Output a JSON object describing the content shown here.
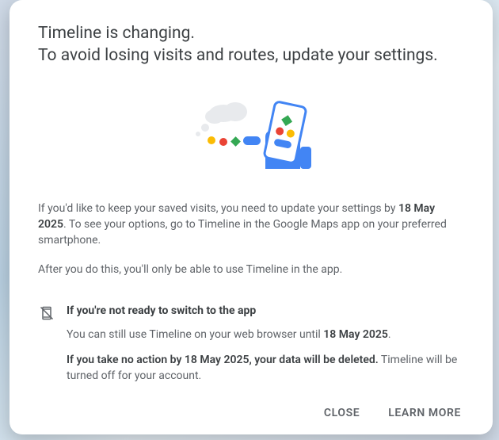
{
  "title": {
    "line1": "Timeline is changing.",
    "line2": "To avoid losing visits and routes, update your settings."
  },
  "body": {
    "p1_pre": "If you'd like to keep your saved visits, you need to update your settings by ",
    "p1_bold": "18 May 2025",
    "p1_post": ". To see your options, go to Timeline in the Google Maps app on your preferred smartphone.",
    "p2": "After you do this, you'll only be able to use Timeline in the app."
  },
  "section": {
    "heading": "If you're not ready to switch to the app",
    "line1_pre": "You can still use Timeline on your web browser until ",
    "line1_bold": "18 May 2025",
    "line1_post": ".",
    "line2_bold": "If you take no action by 18 May 2025, your data will be deleted.",
    "line2_post": " Timeline will be turned off for your account."
  },
  "actions": {
    "close": "CLOSE",
    "learn_more": "LEARN MORE"
  },
  "colors": {
    "text_primary": "#3c4043",
    "text_secondary": "#5f6368",
    "g_blue": "#4285f4",
    "g_red": "#ea4335",
    "g_yellow": "#fbbc04",
    "g_green": "#34a853"
  }
}
